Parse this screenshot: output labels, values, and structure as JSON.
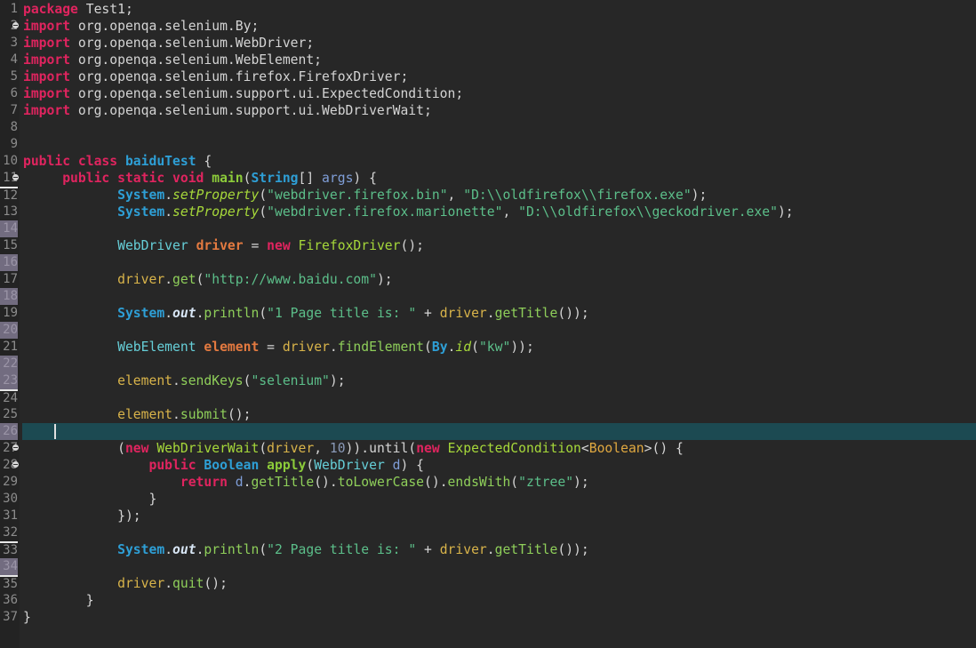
{
  "editor": {
    "current_line": 26,
    "colors": {
      "background": "#272727",
      "gutter": "#232323",
      "current_line": "#1c4a52",
      "keyword": "#e0245f",
      "string": "#5cbf8a"
    },
    "fold_lines": [
      2,
      11,
      27,
      28
    ],
    "marked_lines": [
      14,
      16,
      18,
      20,
      22,
      23,
      26,
      34
    ],
    "underlined_lines": [
      12,
      24,
      33,
      35
    ],
    "lines": [
      [
        [
          "kw",
          "package"
        ],
        [
          "plain",
          " Test1;"
        ]
      ],
      [
        [
          "kw",
          "import"
        ],
        [
          "plain",
          " org.openqa.selenium.By;"
        ]
      ],
      [
        [
          "kw",
          "import"
        ],
        [
          "plain",
          " org.openqa.selenium.WebDriver;"
        ]
      ],
      [
        [
          "kw",
          "import"
        ],
        [
          "plain",
          " org.openqa.selenium.WebElement;"
        ]
      ],
      [
        [
          "kw",
          "import"
        ],
        [
          "plain",
          " org.openqa.selenium.firefox.FirefoxDriver;"
        ]
      ],
      [
        [
          "kw",
          "import"
        ],
        [
          "plain",
          " org.openqa.selenium.support.ui.ExpectedCondition;"
        ]
      ],
      [
        [
          "kw",
          "import"
        ],
        [
          "plain",
          " org.openqa.selenium.support.ui.WebDriverWait;"
        ]
      ],
      [],
      [],
      [
        [
          "kw",
          "public class"
        ],
        [
          "plain",
          " "
        ],
        [
          "cls",
          "baiduTest"
        ],
        [
          "plain",
          " {"
        ]
      ],
      [
        [
          "plain",
          "     "
        ],
        [
          "kw",
          "public static void"
        ],
        [
          "plain",
          " "
        ],
        [
          "fn",
          "main"
        ],
        [
          "plain",
          "("
        ],
        [
          "btype",
          "String"
        ],
        [
          "plain",
          "[] "
        ],
        [
          "param",
          "args"
        ],
        [
          "plain",
          ") {"
        ]
      ],
      [
        [
          "plain",
          "            "
        ],
        [
          "btype",
          "System"
        ],
        [
          "plain",
          "."
        ],
        [
          "smeth",
          "setProperty"
        ],
        [
          "plain",
          "("
        ],
        [
          "str",
          "\"webdriver.firefox.bin\""
        ],
        [
          "plain",
          ", "
        ],
        [
          "str",
          "\"D:\\\\oldfirefox\\\\firefox.exe\""
        ],
        [
          "plain",
          ");"
        ]
      ],
      [
        [
          "plain",
          "            "
        ],
        [
          "btype",
          "System"
        ],
        [
          "plain",
          "."
        ],
        [
          "smeth",
          "setProperty"
        ],
        [
          "plain",
          "("
        ],
        [
          "str",
          "\"webdriver.firefox.marionette\""
        ],
        [
          "plain",
          ", "
        ],
        [
          "str",
          "\"D:\\\\oldfirefox\\\\geckodriver.exe\""
        ],
        [
          "plain",
          ");"
        ]
      ],
      [],
      [
        [
          "plain",
          "            "
        ],
        [
          "type",
          "WebDriver"
        ],
        [
          "plain",
          " "
        ],
        [
          "decl",
          "driver"
        ],
        [
          "plain",
          " = "
        ],
        [
          "kw",
          "new"
        ],
        [
          "plain",
          " "
        ],
        [
          "ctype",
          "FirefoxDriver"
        ],
        [
          "plain",
          "();"
        ]
      ],
      [],
      [
        [
          "plain",
          "            "
        ],
        [
          "var",
          "driver"
        ],
        [
          "plain",
          "."
        ],
        [
          "meth",
          "get"
        ],
        [
          "plain",
          "("
        ],
        [
          "str",
          "\"http://www.baidu.com\""
        ],
        [
          "plain",
          ");"
        ]
      ],
      [],
      [
        [
          "plain",
          "            "
        ],
        [
          "btype",
          "System"
        ],
        [
          "plain",
          "."
        ],
        [
          "field",
          "out"
        ],
        [
          "plain",
          "."
        ],
        [
          "meth",
          "println"
        ],
        [
          "plain",
          "("
        ],
        [
          "str",
          "\"1 Page title is: \""
        ],
        [
          "plain",
          " + "
        ],
        [
          "var",
          "driver"
        ],
        [
          "plain",
          "."
        ],
        [
          "meth",
          "getTitle"
        ],
        [
          "plain",
          "());"
        ]
      ],
      [],
      [
        [
          "plain",
          "            "
        ],
        [
          "type",
          "WebElement"
        ],
        [
          "plain",
          " "
        ],
        [
          "decl",
          "element"
        ],
        [
          "plain",
          " = "
        ],
        [
          "var",
          "driver"
        ],
        [
          "plain",
          "."
        ],
        [
          "meth",
          "findElement"
        ],
        [
          "plain",
          "("
        ],
        [
          "btype",
          "By"
        ],
        [
          "plain",
          "."
        ],
        [
          "smeth",
          "id"
        ],
        [
          "plain",
          "("
        ],
        [
          "str",
          "\"kw\""
        ],
        [
          "plain",
          "));"
        ]
      ],
      [],
      [
        [
          "plain",
          "            "
        ],
        [
          "var",
          "element"
        ],
        [
          "plain",
          "."
        ],
        [
          "meth",
          "sendKeys"
        ],
        [
          "plain",
          "("
        ],
        [
          "str",
          "\"selenium\""
        ],
        [
          "plain",
          ");"
        ]
      ],
      [],
      [
        [
          "plain",
          "            "
        ],
        [
          "var",
          "element"
        ],
        [
          "plain",
          "."
        ],
        [
          "meth",
          "submit"
        ],
        [
          "plain",
          "();"
        ]
      ],
      [],
      [
        [
          "plain",
          "            ("
        ],
        [
          "kw",
          "new"
        ],
        [
          "plain",
          " "
        ],
        [
          "ctype",
          "WebDriverWait"
        ],
        [
          "plain",
          "("
        ],
        [
          "var",
          "driver"
        ],
        [
          "plain",
          ", "
        ],
        [
          "num",
          "10"
        ],
        [
          "plain",
          ")).until("
        ],
        [
          "kw",
          "new"
        ],
        [
          "plain",
          " "
        ],
        [
          "ctype",
          "ExpectedCondition"
        ],
        [
          "plain",
          "<"
        ],
        [
          "gen",
          "Boolean"
        ],
        [
          "plain",
          ">() {"
        ]
      ],
      [
        [
          "plain",
          "                "
        ],
        [
          "kw",
          "public"
        ],
        [
          "plain",
          " "
        ],
        [
          "btype",
          "Boolean"
        ],
        [
          "plain",
          " "
        ],
        [
          "fn",
          "apply"
        ],
        [
          "plain",
          "("
        ],
        [
          "type",
          "WebDriver"
        ],
        [
          "plain",
          " "
        ],
        [
          "param",
          "d"
        ],
        [
          "plain",
          ") {"
        ]
      ],
      [
        [
          "plain",
          "                    "
        ],
        [
          "kw",
          "return"
        ],
        [
          "plain",
          " "
        ],
        [
          "param",
          "d"
        ],
        [
          "plain",
          "."
        ],
        [
          "meth",
          "getTitle"
        ],
        [
          "plain",
          "()."
        ],
        [
          "meth",
          "toLowerCase"
        ],
        [
          "plain",
          "()."
        ],
        [
          "meth",
          "endsWith"
        ],
        [
          "plain",
          "("
        ],
        [
          "str",
          "\"ztree\""
        ],
        [
          "plain",
          ");"
        ]
      ],
      [
        [
          "plain",
          "                }"
        ]
      ],
      [
        [
          "plain",
          "            });"
        ]
      ],
      [],
      [
        [
          "plain",
          "            "
        ],
        [
          "btype",
          "System"
        ],
        [
          "plain",
          "."
        ],
        [
          "field",
          "out"
        ],
        [
          "plain",
          "."
        ],
        [
          "meth",
          "println"
        ],
        [
          "plain",
          "("
        ],
        [
          "str",
          "\"2 Page title is: \""
        ],
        [
          "plain",
          " + "
        ],
        [
          "var",
          "driver"
        ],
        [
          "plain",
          "."
        ],
        [
          "meth",
          "getTitle"
        ],
        [
          "plain",
          "());"
        ]
      ],
      [],
      [
        [
          "plain",
          "            "
        ],
        [
          "var",
          "driver"
        ],
        [
          "plain",
          "."
        ],
        [
          "meth",
          "quit"
        ],
        [
          "plain",
          "();"
        ]
      ],
      [
        [
          "plain",
          "        }"
        ]
      ],
      [
        [
          "plain",
          "}"
        ]
      ]
    ]
  }
}
